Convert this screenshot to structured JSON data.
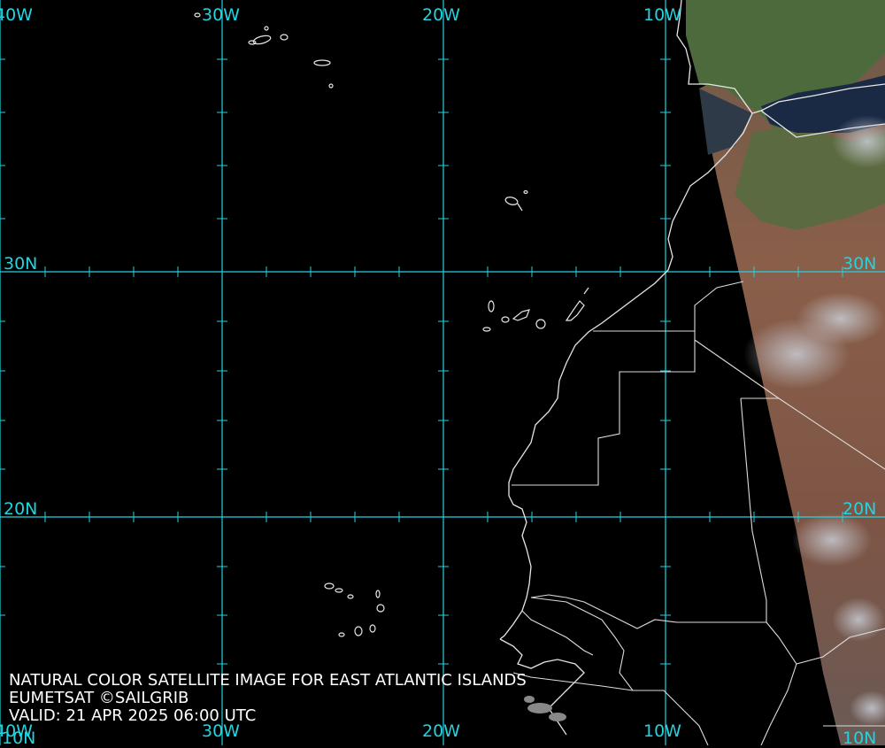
{
  "caption": {
    "line1": "NATURAL COLOR SATELLITE IMAGE FOR EAST ATLANTIC ISLANDS",
    "line2": "EUMETSAT ©SAILGRIB",
    "line3": "VALID:  21 APR 2025 06:00 UTC"
  },
  "graticule": {
    "longitudes": [
      "40W",
      "30W",
      "20W",
      "10W"
    ],
    "latitudes": [
      "30N",
      "20N",
      "10N"
    ],
    "color": "#22d3e0"
  },
  "colors": {
    "ocean": "#000000",
    "coastline": "#e6e6e6",
    "land_green": "#4d6a3c",
    "land_desert": "#7a5642",
    "sea_blue": "#1a2a45"
  }
}
